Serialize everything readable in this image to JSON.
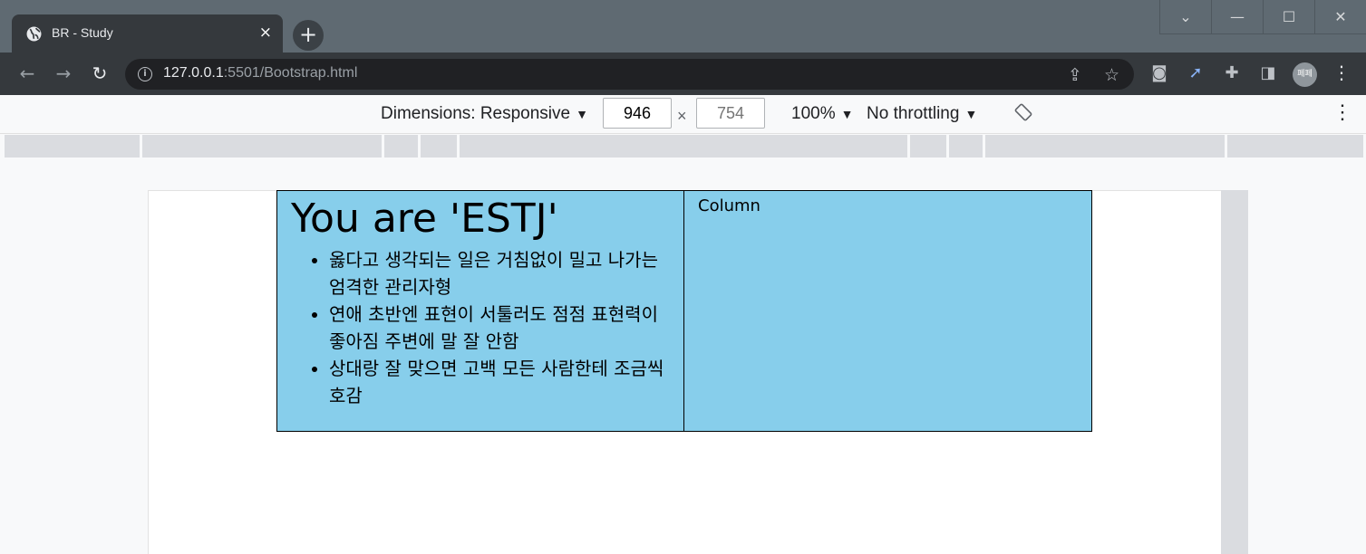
{
  "browser": {
    "tab_title": "BR - Study",
    "tab_close": "×",
    "new_tab": "+",
    "url_host": "127.0.0.1",
    "url_rest": ":5501/Bootstrap.html",
    "profile_initials": "페페"
  },
  "devtools": {
    "dimensions_label": "Dimensions: Responsive",
    "width_value": "946",
    "height_placeholder": "754",
    "times": "×",
    "zoom": "100%",
    "throttling": "No throttling"
  },
  "page": {
    "heading": "You are 'ESTJ'",
    "traits": [
      "옳다고 생각되는 일은 거침없이 밀고 나가는 엄격한 관리자형",
      "연애 초반엔 표현이 서툴러도 점점 표현력이 좋아짐 주변에 말 잘 안함",
      "상대랑 잘 맞으면 고백 모든 사람한테 조금씩 호감"
    ],
    "column_text": "Column"
  },
  "colors": {
    "column_bg": "#87ceeb",
    "tab_strip": "#5f6a72",
    "toolbar": "#35393d"
  }
}
